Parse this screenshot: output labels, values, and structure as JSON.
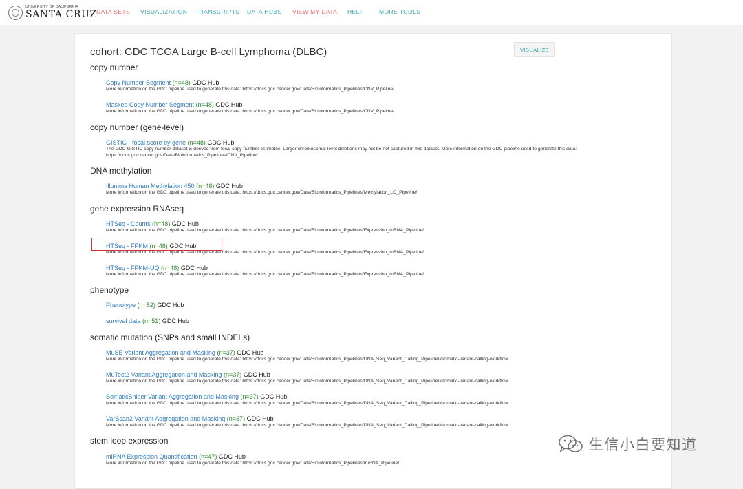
{
  "logo": {
    "small_text": "UNIVERSITY OF CALIFORNIA",
    "big_text": "SANTA CRUZ"
  },
  "nav": [
    {
      "label": "DATA SETS",
      "color": "#ee6b6b"
    },
    {
      "label": "VISUALIZATION",
      "color": "#3ba5ab"
    },
    {
      "label": "TRANSCRIPTS",
      "color": "#3ba5ab"
    },
    {
      "label": "DATA HUBS",
      "color": "#3ba5ab"
    },
    {
      "label": "VIEW MY DATA",
      "color": "#ee6b6b"
    },
    {
      "label": "HELP",
      "color": "#3ba5ab"
    },
    {
      "label": "MORE TOOLS",
      "color": "#3ba5ab"
    }
  ],
  "cohort": {
    "title": "cohort: GDC TCGA Large B-cell Lymphoma (DLBC)",
    "visualize_label": "VISUALIZE"
  },
  "sections": [
    {
      "title": "copy number",
      "datasets": [
        {
          "name": "Copy Number Segment",
          "count": "(n=48)",
          "hub": "GDC Hub",
          "desc": "More information on the GDC pipeline used to generate this data: https://docs.gdc.cancer.gov/Data/Bioinformatics_Pipelines/CNV_Pipeline/"
        },
        {
          "name": "Masked Copy Number Segment",
          "count": "(n=48)",
          "hub": "GDC Hub",
          "desc": "More information on the GDC pipeline used to generate this data: https://docs.gdc.cancer.gov/Data/Bioinformatics_Pipelines/CNV_Pipeline/"
        }
      ]
    },
    {
      "title": "copy number (gene-level)",
      "datasets": [
        {
          "name": "GISTIC - focal score by gene",
          "count": "(n=48)",
          "hub": "GDC Hub",
          "desc": "The GDC GISTIC copy number dataset is derived from focal copy number estimates. Larger chromosomal-level deletions may not be not captured in this dataset. More information on the GDC pipeline used to generate this data: https://docs.gdc.cancer.gov/Data/Bioinformatics_Pipelines/CNV_Pipeline/"
        }
      ]
    },
    {
      "title": "DNA methylation",
      "datasets": [
        {
          "name": "Illumina Human Methylation 450",
          "count": "(n=48)",
          "hub": "GDC Hub",
          "desc": "More information on the GDC pipeline used to generate this data: https://docs.gdc.cancer.gov/Data/Bioinformatics_Pipelines/Methylation_LO_Pipeline/"
        }
      ]
    },
    {
      "title": "gene expression RNAseq",
      "datasets": [
        {
          "name": "HTSeq - Counts",
          "count": "(n=48)",
          "hub": "GDC Hub",
          "desc": "More information on the GDC pipeline used to generate this data: https://docs.gdc.cancer.gov/Data/Bioinformatics_Pipelines/Expression_mRNA_Pipeline/"
        },
        {
          "name": "HTSeq - FPKM",
          "count": "(n=48)",
          "hub": "GDC Hub",
          "desc": "More information on the GDC pipeline used to generate this data: https://docs.gdc.cancer.gov/Data/Bioinformatics_Pipelines/Expression_mRNA_Pipeline/"
        },
        {
          "name": "HTSeq - FPKM-UQ",
          "count": "(n=48)",
          "hub": "GDC Hub",
          "desc": "More information on the GDC pipeline used to generate this data: https://docs.gdc.cancer.gov/Data/Bioinformatics_Pipelines/Expression_mRNA_Pipeline/"
        }
      ]
    },
    {
      "title": "phenotype",
      "datasets": [
        {
          "name": "Phenotype",
          "count": "(n=52)",
          "hub": "GDC Hub",
          "desc": ""
        },
        {
          "name": "survival data",
          "count": "(n=51)",
          "hub": "GDC Hub",
          "desc": ""
        }
      ]
    },
    {
      "title": "somatic mutation (SNPs and small INDELs)",
      "datasets": [
        {
          "name": "MuSE Variant Aggregation and Masking",
          "count": "(n=37)",
          "hub": "GDC Hub",
          "desc": "More information on the GDC pipeline used to generate this data: https://docs.gdc.cancer.gov/Data/Bioinformatics_Pipelines/DNA_Seq_Variant_Calling_Pipeline/#somatic-variant-calling-workflow"
        },
        {
          "name": "MuTect2 Variant Aggregation and Masking",
          "count": "(n=37)",
          "hub": "GDC Hub",
          "desc": "More information on the GDC pipeline used to generate this data: https://docs.gdc.cancer.gov/Data/Bioinformatics_Pipelines/DNA_Seq_Variant_Calling_Pipeline/#somatic-variant-calling-workflow"
        },
        {
          "name": "SomaticSniper Variant Aggregation and Masking",
          "count": "(n=37)",
          "hub": "GDC Hub",
          "desc": "More information on the GDC pipeline used to generate this data: https://docs.gdc.cancer.gov/Data/Bioinformatics_Pipelines/DNA_Seq_Variant_Calling_Pipeline/#somatic-variant-calling-workflow"
        },
        {
          "name": "VarScan2 Variant Aggregation and Masking",
          "count": "(n=37)",
          "hub": "GDC Hub",
          "desc": "More information on the GDC pipeline used to generate this data: https://docs.gdc.cancer.gov/Data/Bioinformatics_Pipelines/DNA_Seq_Variant_Calling_Pipeline/#somatic-variant-calling-workflow"
        }
      ]
    },
    {
      "title": "stem loop expression",
      "datasets": [
        {
          "name": "miRNA Expression Quantification",
          "count": "(n=47)",
          "hub": "GDC Hub",
          "desc": "More information on the GDC pipeline used to generate this data: https://docs.gdc.cancer.gov/Data/Bioinformatics_Pipelines/miRNA_Pipeline/"
        }
      ]
    }
  ],
  "watermark": {
    "text": "生信小白要知道",
    "icon": "wechat-icon"
  }
}
